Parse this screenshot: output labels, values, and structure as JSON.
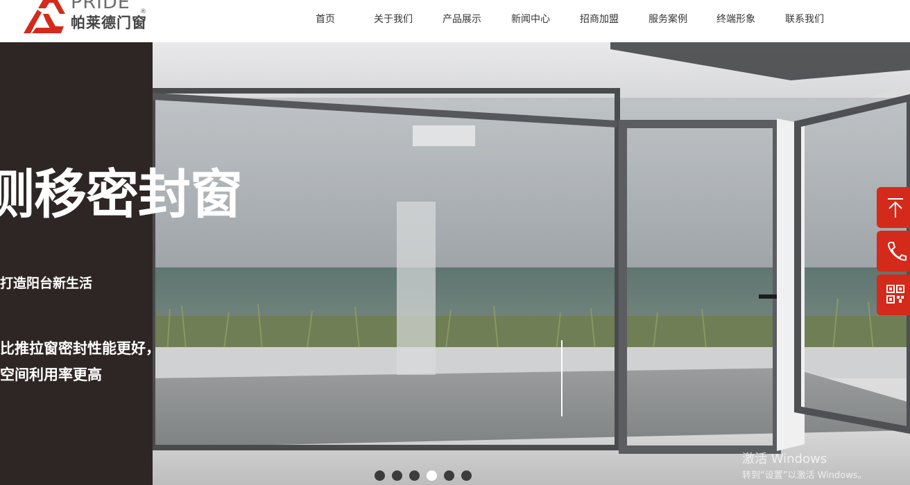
{
  "brand": {
    "name_en": "PRIDE",
    "name_cn": "帕莱德门窗",
    "registered": "®",
    "accent": "#d42a1b"
  },
  "nav": {
    "items": [
      {
        "label": "首页"
      },
      {
        "label": "关于我们"
      },
      {
        "label": "产品展示"
      },
      {
        "label": "新闻中心"
      },
      {
        "label": "招商加盟"
      },
      {
        "label": "服务案例"
      },
      {
        "label": "终端形象"
      },
      {
        "label": "联系我们"
      }
    ]
  },
  "hero": {
    "title": "侧移密封窗",
    "subtitle": "打造阳台新生活",
    "desc_line1": "比推拉窗密封性能更好，",
    "desc_line2": "空间利用率更高",
    "slides_total": 6,
    "active_slide": 4,
    "panel_color": "#2e2624"
  },
  "side_tools": [
    {
      "icon": "arrow-up-icon"
    },
    {
      "icon": "phone-icon"
    },
    {
      "icon": "qr-code-icon"
    }
  ],
  "watermark": {
    "line1": "激活 Windows",
    "line2": "转到“设置”以激活 Windows。"
  }
}
